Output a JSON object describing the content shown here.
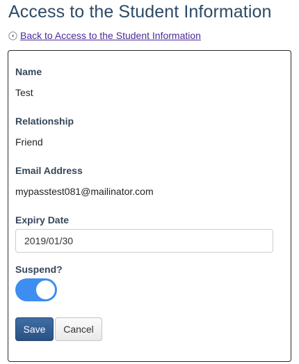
{
  "page": {
    "title": "Access to the Student Information",
    "back_link": " Back to Access to the Student Information"
  },
  "form": {
    "name_label": "Name",
    "name_value": "Test",
    "relationship_label": "Relationship",
    "relationship_value": "Friend",
    "email_label": "Email Address",
    "email_value": "mypasstest081@mailinator.com",
    "expiry_label": "Expiry Date",
    "expiry_value": "2019/01/30",
    "suspend_label": "Suspend?",
    "suspend_on": true,
    "save_label": "Save",
    "cancel_label": "Cancel"
  },
  "colors": {
    "title": "#2c4a66",
    "link": "#4b2a9a",
    "toggle_on": "#3d8ef0",
    "save_button": "#2b5184"
  },
  "icons": {
    "back": "back-arrow-circle-icon"
  }
}
